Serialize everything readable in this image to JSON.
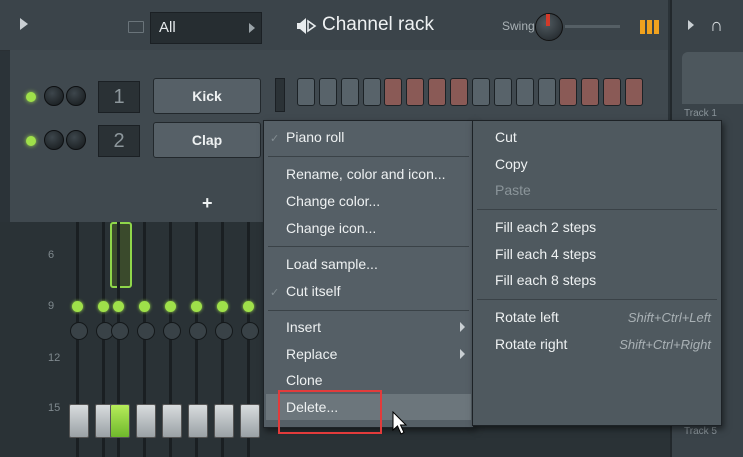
{
  "top_bar": {
    "filter_value": "All",
    "title": "Channel rack",
    "swing_label": "Swing",
    "icons": [
      "play-arrow-icon",
      "folder-icon",
      "speaker-icon",
      "swing-knob",
      "graph-icon"
    ]
  },
  "right_panel": {
    "track_1": "Track 1",
    "track_5": "Track 5"
  },
  "channels": [
    {
      "number": "1",
      "name": "Kick"
    },
    {
      "number": "2",
      "name": "Clap"
    }
  ],
  "add_label": "+",
  "mixer_numbers": [
    "6",
    "9",
    "12",
    "15"
  ],
  "menu_left": {
    "items": [
      {
        "label": "Piano roll",
        "checked": true
      },
      {
        "label": "Rename, color and icon..."
      },
      {
        "label": "Change color..."
      },
      {
        "label": "Change icon..."
      },
      {
        "label": "Load sample..."
      },
      {
        "label": "Cut itself",
        "checked": true
      },
      {
        "label": "Insert",
        "submenu": true
      },
      {
        "label": "Replace",
        "submenu": true
      },
      {
        "label": "Clone"
      },
      {
        "label": "Delete...",
        "highlighted": true
      }
    ]
  },
  "menu_right": {
    "items": [
      {
        "label": "Cut"
      },
      {
        "label": "Copy"
      },
      {
        "label": "Paste",
        "disabled": true
      },
      {
        "label": "Fill each 2 steps"
      },
      {
        "label": "Fill each 4 steps"
      },
      {
        "label": "Fill each 8 steps"
      },
      {
        "label": "Rotate left",
        "shortcut": "Shift+Ctrl+Left"
      },
      {
        "label": "Rotate right",
        "shortcut": "Shift+Ctrl+Right"
      }
    ]
  },
  "colors": {
    "accent_orange": "#f0a21e",
    "led_green": "#9fe04a",
    "highlight_red": "#e23b3b"
  }
}
